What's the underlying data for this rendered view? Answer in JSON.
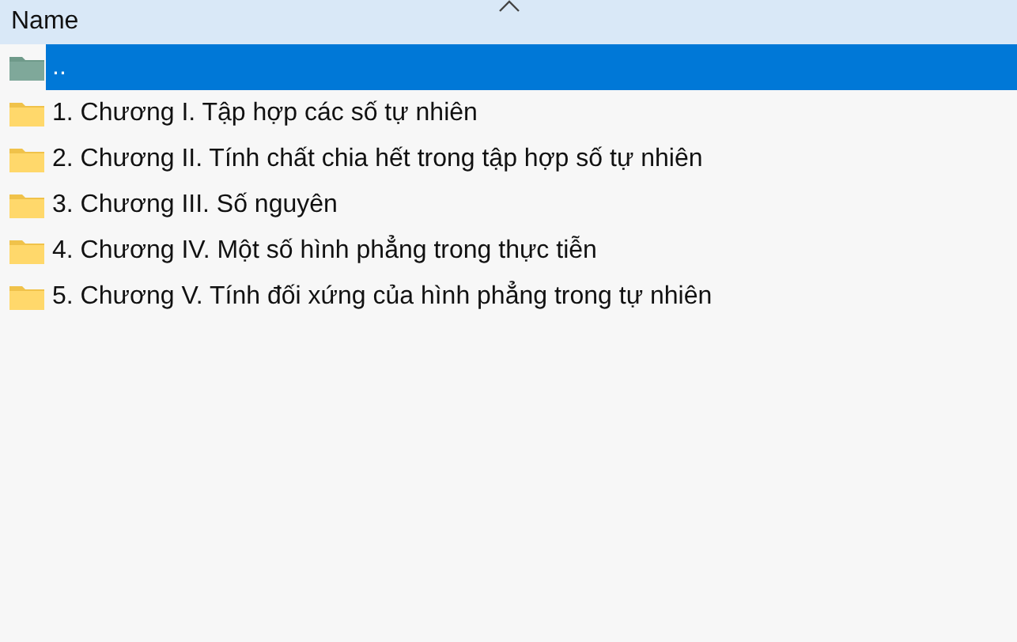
{
  "header": {
    "column_1": "Name"
  },
  "rows": [
    {
      "kind": "parent",
      "name": "..",
      "selected": true
    },
    {
      "kind": "folder",
      "name": "1. Chương I. Tập hợp các số tự nhiên",
      "selected": false
    },
    {
      "kind": "folder",
      "name": "2. Chương II. Tính chất chia hết trong tập hợp số tự nhiên",
      "selected": false
    },
    {
      "kind": "folder",
      "name": "3. Chương III. Số nguyên",
      "selected": false
    },
    {
      "kind": "folder",
      "name": "4. Chương IV. Một số hình phẳng trong thực tiễn",
      "selected": false
    },
    {
      "kind": "folder",
      "name": "5. Chương V. Tính đối xứng của hình phẳng trong tự nhiên",
      "selected": false
    }
  ]
}
